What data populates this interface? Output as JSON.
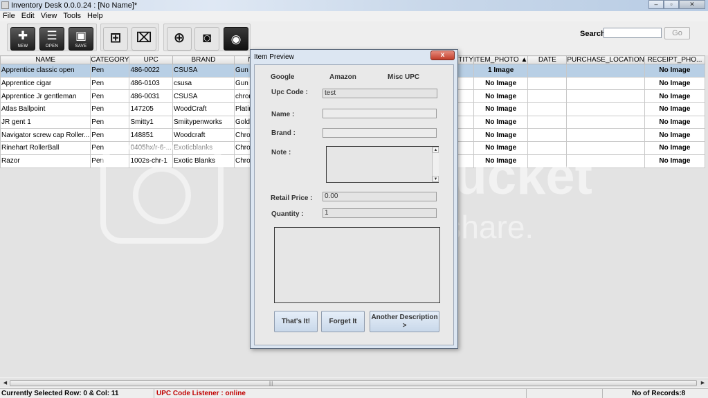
{
  "window": {
    "title": "Inventory Desk 0.0.0.24 : [No Name]*",
    "buttons": [
      "–",
      "▫",
      "✕"
    ]
  },
  "menu": [
    "File",
    "Edit",
    "View",
    "Tools",
    "Help"
  ],
  "toolbar": {
    "new_label": "NEW",
    "open_label": "OPEN",
    "save_label": "SAVE",
    "search_label": "Search",
    "search_value": "",
    "go_label": "Go"
  },
  "table": {
    "columns": [
      "NAME",
      "CATEGORY",
      "UPC",
      "BRAND",
      "N",
      "ANTITY",
      "ITEM_PHOTO ▲",
      "DATE",
      "PURCHASE_LOCATION",
      "RECEIPT_PHO..."
    ],
    "rows": [
      {
        "name": "Apprentice classic open",
        "category": "Pen",
        "upc": "486-0022",
        "brand": "CSUSA",
        "material": "Gun met",
        "photo": "1 Image",
        "receipt": "No Image"
      },
      {
        "name": "Apprentice cigar",
        "category": "Pen",
        "upc": "486-0103",
        "brand": "csusa",
        "material": "Gun Meta",
        "photo": "No Image",
        "receipt": "No Image"
      },
      {
        "name": "Apprentice Jr gentleman",
        "category": "Pen",
        "upc": "486-0031",
        "brand": "CSUSA",
        "material": "chrome",
        "photo": "No Image",
        "receipt": "No Image"
      },
      {
        "name": "Atlas Ballpoint",
        "category": "Pen",
        "upc": "147205",
        "brand": "WoodCraft",
        "material": "Platinum",
        "photo": "No Image",
        "receipt": "No Image"
      },
      {
        "name": "JR gent 1",
        "category": "Pen",
        "upc": "Smitty1",
        "brand": "Smiitypenworks",
        "material": "Gold/Tita",
        "photo": "No Image",
        "receipt": "No Image"
      },
      {
        "name": "Navigator screw cap Roller...",
        "category": "Pen",
        "upc": "148851",
        "brand": "Woodcraft",
        "material": "Chrome",
        "photo": "No Image",
        "receipt": "No Image"
      },
      {
        "name": "Rinehart RollerBall",
        "category": "Pen",
        "upc": "0405hx/r-6-...",
        "brand": "Exoticblanks",
        "material": "Chrome",
        "photo": "No Image",
        "receipt": "No Image"
      },
      {
        "name": "Razor",
        "category": "Pen",
        "upc": "1002s-chr-1",
        "brand": "Exotic Blanks",
        "material": "Chrome",
        "photo": "No Image",
        "receipt": "No Image"
      }
    ]
  },
  "status": {
    "selection": "Currently Selected Row: 0 & Col: 11",
    "listener": "UPC Code Listener : online",
    "records": "No of Records:8"
  },
  "dialog": {
    "title": "Item Preview",
    "close": "x",
    "tabs": [
      "Google",
      "Amazon",
      "Misc UPC"
    ],
    "upc_label": "Upc Code :",
    "upc_value": "test",
    "name_label": "Name :",
    "name_value": "",
    "brand_label": "Brand :",
    "brand_value": "",
    "note_label": "Note :",
    "note_value": "",
    "retail_label": "Retail Price :",
    "retail_value": "0.00",
    "quantity_label": "Quantity :",
    "quantity_value": "1",
    "btn_thats_it": "That's It!",
    "btn_forget_it": "Forget It",
    "btn_another": "Another Description >"
  },
  "watermark": {
    "line1": "photobucket",
    "line2": "host. store. share."
  },
  "colors": {
    "selected_row": "#b8cfe5",
    "listener_text": "#c00000",
    "dialog_frame": "#dce6f2"
  }
}
